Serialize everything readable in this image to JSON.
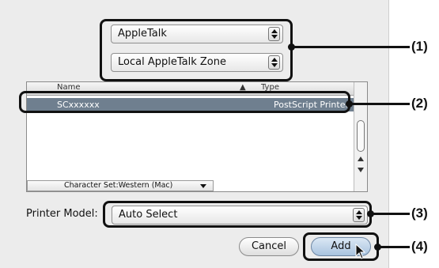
{
  "dialog": {
    "connection_popup": "AppleTalk",
    "zone_popup": "Local AppleTalk Zone",
    "list": {
      "columns": {
        "name": "Name",
        "type": "Type"
      },
      "selected_row": {
        "name": "SCxxxxxx",
        "type": "PostScript Printer"
      }
    },
    "charset_popup": "Character Set:Western (Mac)",
    "printer_model_label": "Printer Model:",
    "printer_model_value": "Auto Select",
    "cancel_label": "Cancel",
    "add_label": "Add"
  },
  "callouts": [
    "(1)",
    "(2)",
    "(3)",
    "(4)"
  ]
}
